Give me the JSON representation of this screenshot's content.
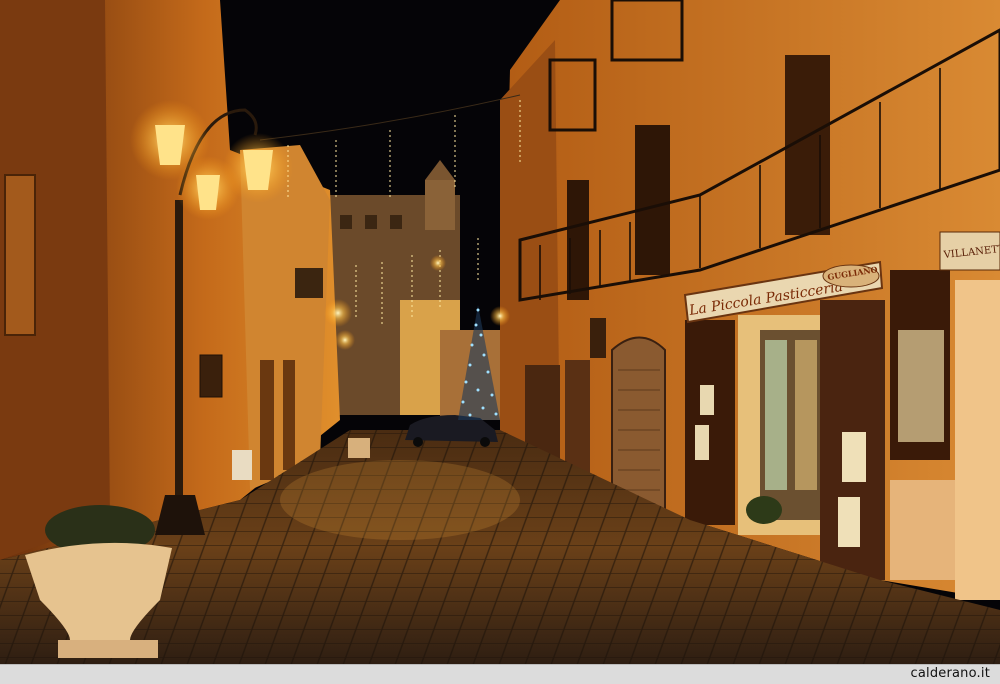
{
  "scene": {
    "description_tag": "night street with christmas tree",
    "colors": {
      "sky": "#050407",
      "wall_warm": "#c9761f",
      "wall_dark": "#5a2a0c",
      "lamp_glow": "#ffe38a",
      "paving": "#3a2616",
      "tree_lights": "#7ecbff"
    }
  },
  "shop": {
    "sign_main": "La Piccola Pasticceria",
    "sign_logo": "GUGLIANO",
    "sign_right": "VILLANETTI"
  },
  "footer": {
    "credit": "calderano.it"
  }
}
